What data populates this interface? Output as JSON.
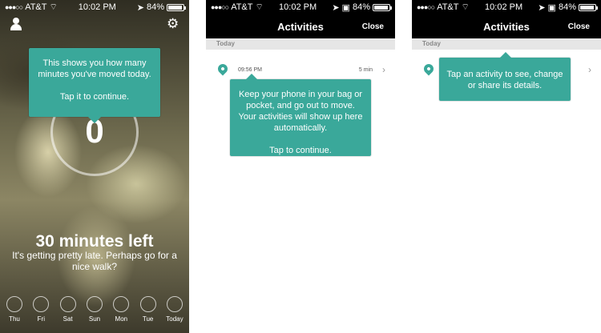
{
  "status": {
    "p1": {
      "carrier": "AT&T",
      "time": "10:02 PM",
      "battery": "84%"
    },
    "p2": {
      "carrier": "AT&T",
      "time": "10:02 PM",
      "battery": "84%"
    },
    "p3": {
      "carrier": "AT&T",
      "time": "10:02 PM",
      "battery": "84%"
    }
  },
  "home": {
    "tooltip_line1": "This shows you how many minutes you've moved today.",
    "tooltip_line2": "Tap it to continue.",
    "minutes": "0",
    "headline": "30 minutes left",
    "subline": "It's getting pretty late. Perhaps go for a nice walk?",
    "days": [
      "Thu",
      "Fri",
      "Sat",
      "Sun",
      "Mon",
      "Tue",
      "Today"
    ],
    "icons": {
      "left": "person-icon",
      "right": "gear-icon"
    }
  },
  "activities1": {
    "title": "Activities",
    "close": "Close",
    "section": "Today",
    "row_time": "09:56 PM",
    "row_minutes": "5 min",
    "tooltip_line1": "Keep your phone in your bag or pocket, and go out to move. Your activities will show up here automatically.",
    "tooltip_line2": "Tap to continue."
  },
  "activities2": {
    "title": "Activities",
    "close": "Close",
    "section": "Today",
    "tooltip": "Tap an activity to see, change or share its details."
  },
  "colors": {
    "accent": "#3aa89a",
    "header": "#000000"
  }
}
